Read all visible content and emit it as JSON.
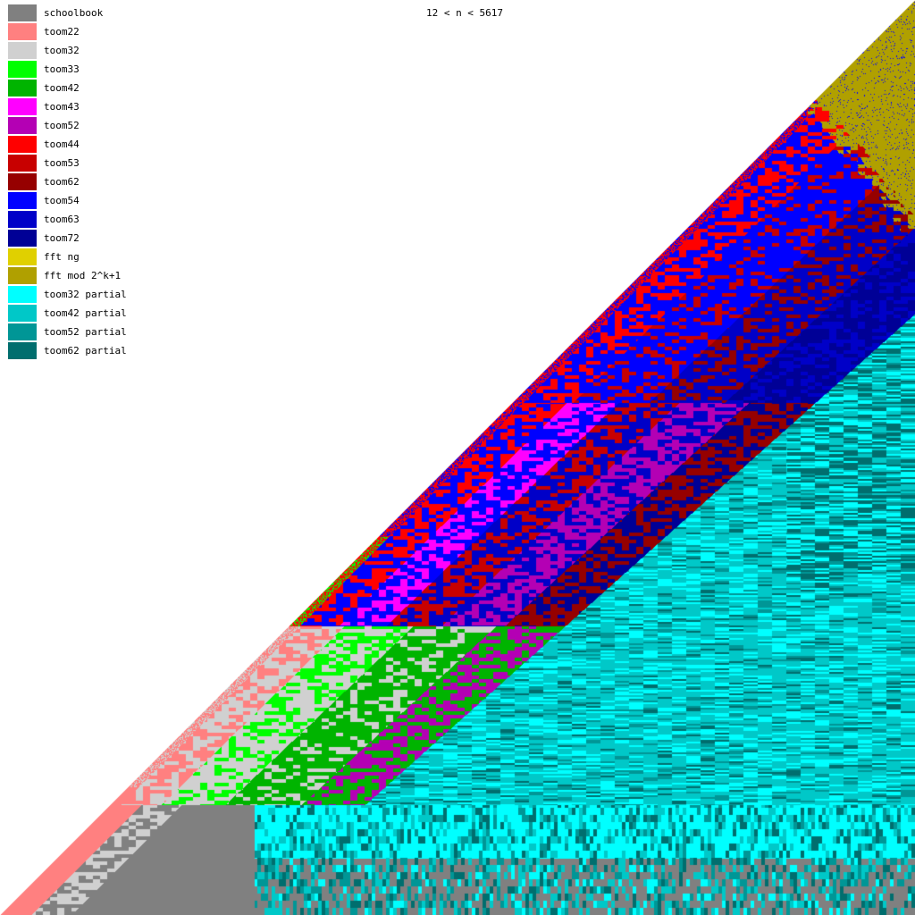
{
  "chart_data": {
    "type": "heatmap",
    "title": "12 < n < 5617",
    "legend": [
      {
        "name": "schoolbook",
        "color": "#808080"
      },
      {
        "name": "toom22",
        "color": "#ff8080"
      },
      {
        "name": "toom32",
        "color": "#d0d0d0"
      },
      {
        "name": "toom33",
        "color": "#00ff00"
      },
      {
        "name": "toom42",
        "color": "#00b400"
      },
      {
        "name": "toom43",
        "color": "#ff00ff"
      },
      {
        "name": "toom52",
        "color": "#b400b4"
      },
      {
        "name": "toom44",
        "color": "#ff0000"
      },
      {
        "name": "toom53",
        "color": "#c80000"
      },
      {
        "name": "toom62",
        "color": "#960000"
      },
      {
        "name": "toom54",
        "color": "#0000ff"
      },
      {
        "name": "toom63",
        "color": "#0000c8"
      },
      {
        "name": "toom72",
        "color": "#000096"
      },
      {
        "name": "fft ng",
        "color": "#e0d000"
      },
      {
        "name": "fft mod 2^k+1",
        "color": "#b0a000"
      },
      {
        "name": "toom32 partial",
        "color": "#00ffff"
      },
      {
        "name": "toom42 partial",
        "color": "#00c8c8"
      },
      {
        "name": "toom52 partial",
        "color": "#009696"
      },
      {
        "name": "toom62 partial",
        "color": "#006e6e"
      }
    ],
    "legend_position": "top-left",
    "background": "#ffffff"
  }
}
